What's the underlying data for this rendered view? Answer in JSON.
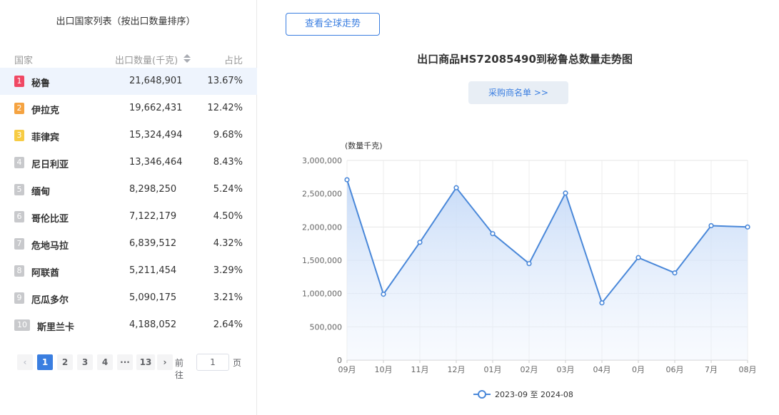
{
  "left": {
    "title": "出口国家列表（按出口数量排序）",
    "header": {
      "country": "国家",
      "quantity": "出口数量(千克)",
      "share": "占比"
    },
    "rows": [
      {
        "rank": "1",
        "country": "秘鲁",
        "quantity": "21,648,901",
        "share": "13.67%",
        "color": "#f04864"
      },
      {
        "rank": "2",
        "country": "伊拉克",
        "quantity": "19,662,431",
        "share": "12.42%",
        "color": "#f5a341"
      },
      {
        "rank": "3",
        "country": "菲律宾",
        "quantity": "15,324,494",
        "share": "9.68%",
        "color": "#f7cc44"
      },
      {
        "rank": "4",
        "country": "尼日利亚",
        "quantity": "13,346,464",
        "share": "8.43%",
        "color": "#c8c9cc"
      },
      {
        "rank": "5",
        "country": "缅甸",
        "quantity": "8,298,250",
        "share": "5.24%",
        "color": "#c8c9cc"
      },
      {
        "rank": "6",
        "country": "哥伦比亚",
        "quantity": "7,122,179",
        "share": "4.50%",
        "color": "#c8c9cc"
      },
      {
        "rank": "7",
        "country": "危地马拉",
        "quantity": "6,839,512",
        "share": "4.32%",
        "color": "#c8c9cc"
      },
      {
        "rank": "8",
        "country": "阿联酋",
        "quantity": "5,211,454",
        "share": "3.29%",
        "color": "#c8c9cc"
      },
      {
        "rank": "9",
        "country": "厄瓜多尔",
        "quantity": "5,090,175",
        "share": "3.21%",
        "color": "#c8c9cc"
      },
      {
        "rank": "10",
        "country": "斯里兰卡",
        "quantity": "4,188,052",
        "share": "2.64%",
        "color": "#c8c9cc"
      }
    ],
    "pager": {
      "prev": "‹",
      "next": "›",
      "pages": [
        "1",
        "2",
        "3",
        "4",
        "···",
        "13"
      ],
      "goto_label": "前往",
      "goto_value": "1",
      "page_label": "页"
    }
  },
  "right": {
    "global_button": "查看全球走势",
    "buyer_button": "采购商名单 >>"
  },
  "colors": {
    "accent": "#3a7ee0",
    "line": "#4a88d9"
  },
  "chart_data": {
    "type": "area",
    "title": "出口商品HS72085490到秘鲁总数量走势图",
    "ylabel": "(数量千克)",
    "x": [
      "09月",
      "10月",
      "11月",
      "12月",
      "01月",
      "02月",
      "03月",
      "04月",
      "05月",
      "06月",
      "07月",
      "08月"
    ],
    "x_labels_shown": [
      "09月",
      "10月",
      "11月",
      "12月",
      "01月",
      "02月",
      "03月",
      "04⁣月",
      "0⁣月",
      "06⁣月",
      "⁣7月",
      "08月"
    ],
    "ylim": [
      0,
      3000000
    ],
    "yticks": [
      "0",
      "500,000",
      "1,000,000",
      "1,500,000",
      "2,000,000",
      "2,500,000",
      "3,000,000"
    ],
    "series": [
      {
        "name": "2023-09 至 2024-08",
        "values": [
          2710000,
          990000,
          1770000,
          2590000,
          1900000,
          1450000,
          2510000,
          860000,
          1540000,
          1310000,
          2020000,
          2000000
        ]
      }
    ],
    "grid": true,
    "legend": "bottom-center"
  }
}
